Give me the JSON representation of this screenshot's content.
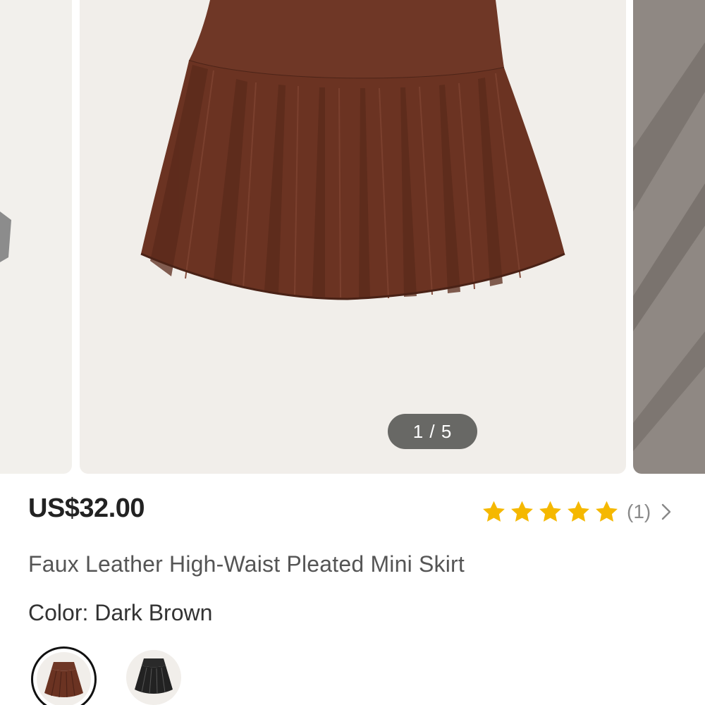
{
  "gallery": {
    "counter": "1 / 5",
    "current_index": 1,
    "total": 5
  },
  "product": {
    "price": "US$32.00",
    "title": "Faux Leather High-Waist Pleated Mini Skirt",
    "color_line": "Color: Dark Brown"
  },
  "rating": {
    "stars": 5,
    "count_label": "(1)"
  },
  "swatches": [
    {
      "name": "Dark Brown",
      "color": "#6b3322",
      "selected": true
    },
    {
      "name": "Black",
      "color": "#222222",
      "selected": false
    }
  ],
  "colors": {
    "star": "#f5b800",
    "skirt": "#6e3524",
    "image_bg": "#f1eeea",
    "counter_bg": "#50504e"
  }
}
